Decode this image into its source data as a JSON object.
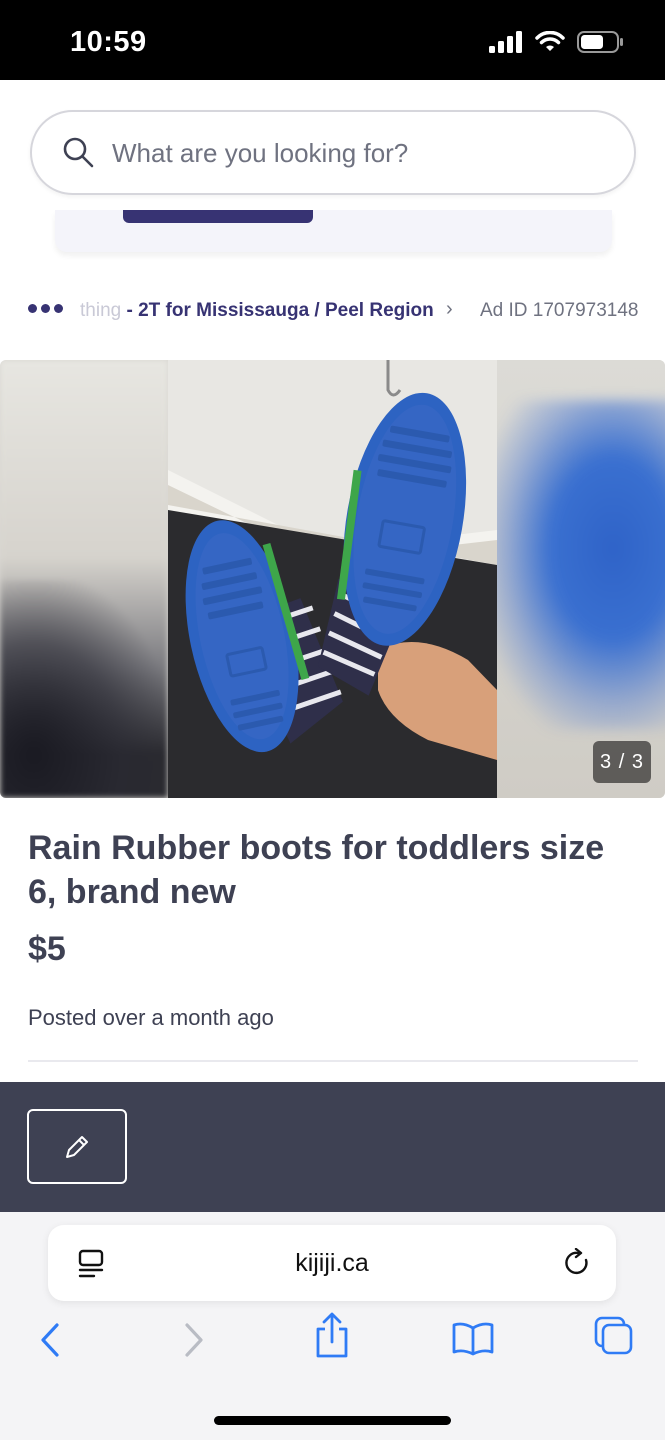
{
  "status_bar": {
    "time": "10:59"
  },
  "search": {
    "placeholder": "What are you looking for?"
  },
  "breadcrumb": {
    "faded_text": "thing",
    "category_text": " - 2T for Mississauga / Peel Region",
    "ad_id": "Ad ID 1707973148"
  },
  "gallery": {
    "counter": "3 / 3"
  },
  "listing": {
    "title": "Rain Rubber boots for toddlers size 6, brand new",
    "price": "$5",
    "posted": "Posted over a month ago"
  },
  "browser": {
    "url": "kijiji.ca"
  },
  "icons": {
    "search": "search-icon",
    "edit": "pencil-icon",
    "reader": "reader-mode-icon",
    "reload": "reload-icon",
    "back": "back-chevron-icon",
    "forward": "forward-chevron-icon",
    "share": "share-icon",
    "bookmarks": "bookmarks-icon",
    "tabs": "tabs-icon"
  },
  "colors": {
    "brand_dark": "#373373",
    "text": "#3e4153",
    "action_bar": "#3e4153",
    "safari_blue": "#2f7bf5"
  }
}
